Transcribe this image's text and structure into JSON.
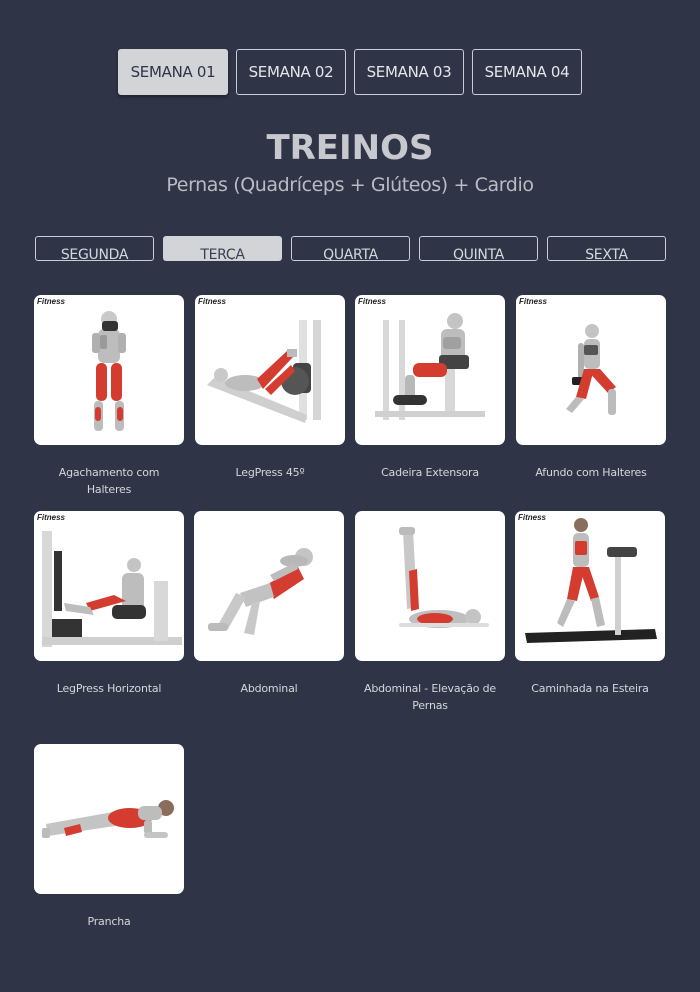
{
  "weeks": [
    {
      "label": "SEMANA 01",
      "active": true
    },
    {
      "label": "SEMANA 02",
      "active": false
    },
    {
      "label": "SEMANA 03",
      "active": false
    },
    {
      "label": "SEMANA 04",
      "active": false
    }
  ],
  "header": {
    "title": "TREINOS",
    "subtitle": "Pernas (Quadríceps + Glúteos) + Cardio"
  },
  "days": [
    {
      "label": "SEGUNDA",
      "active": false
    },
    {
      "label": "TERÇA",
      "active": true
    },
    {
      "label": "QUARTA",
      "active": false
    },
    {
      "label": "QUINTA",
      "active": false
    },
    {
      "label": "SEXTA",
      "active": false
    }
  ],
  "logo_text": "Fitness",
  "exercises": [
    {
      "label": "Agachamento com Halteres",
      "icon": "squat-dumbbell-icon",
      "logo": true
    },
    {
      "label": "LegPress 45º",
      "icon": "leg-press-45-icon",
      "logo": true
    },
    {
      "label": "Cadeira Extensora",
      "icon": "leg-extension-machine-icon",
      "logo": true
    },
    {
      "label": "Afundo com Halteres",
      "icon": "lunge-dumbbell-icon",
      "logo": true
    },
    {
      "label": "LegPress Horizontal",
      "icon": "horizontal-leg-press-icon",
      "logo": true
    },
    {
      "label": "Abdominal",
      "icon": "crunch-icon",
      "logo": false
    },
    {
      "label": "Abdominal - Elevação de Pernas",
      "icon": "leg-raise-icon",
      "logo": false
    },
    {
      "label": "Caminhada na Esteira",
      "icon": "treadmill-walk-icon",
      "logo": true
    },
    {
      "label": "Prancha",
      "icon": "plank-icon",
      "logo": false
    }
  ],
  "colors": {
    "background": "#2f3446",
    "active_tab": "#d3d4d8",
    "muscle_highlight": "#d43c30"
  }
}
